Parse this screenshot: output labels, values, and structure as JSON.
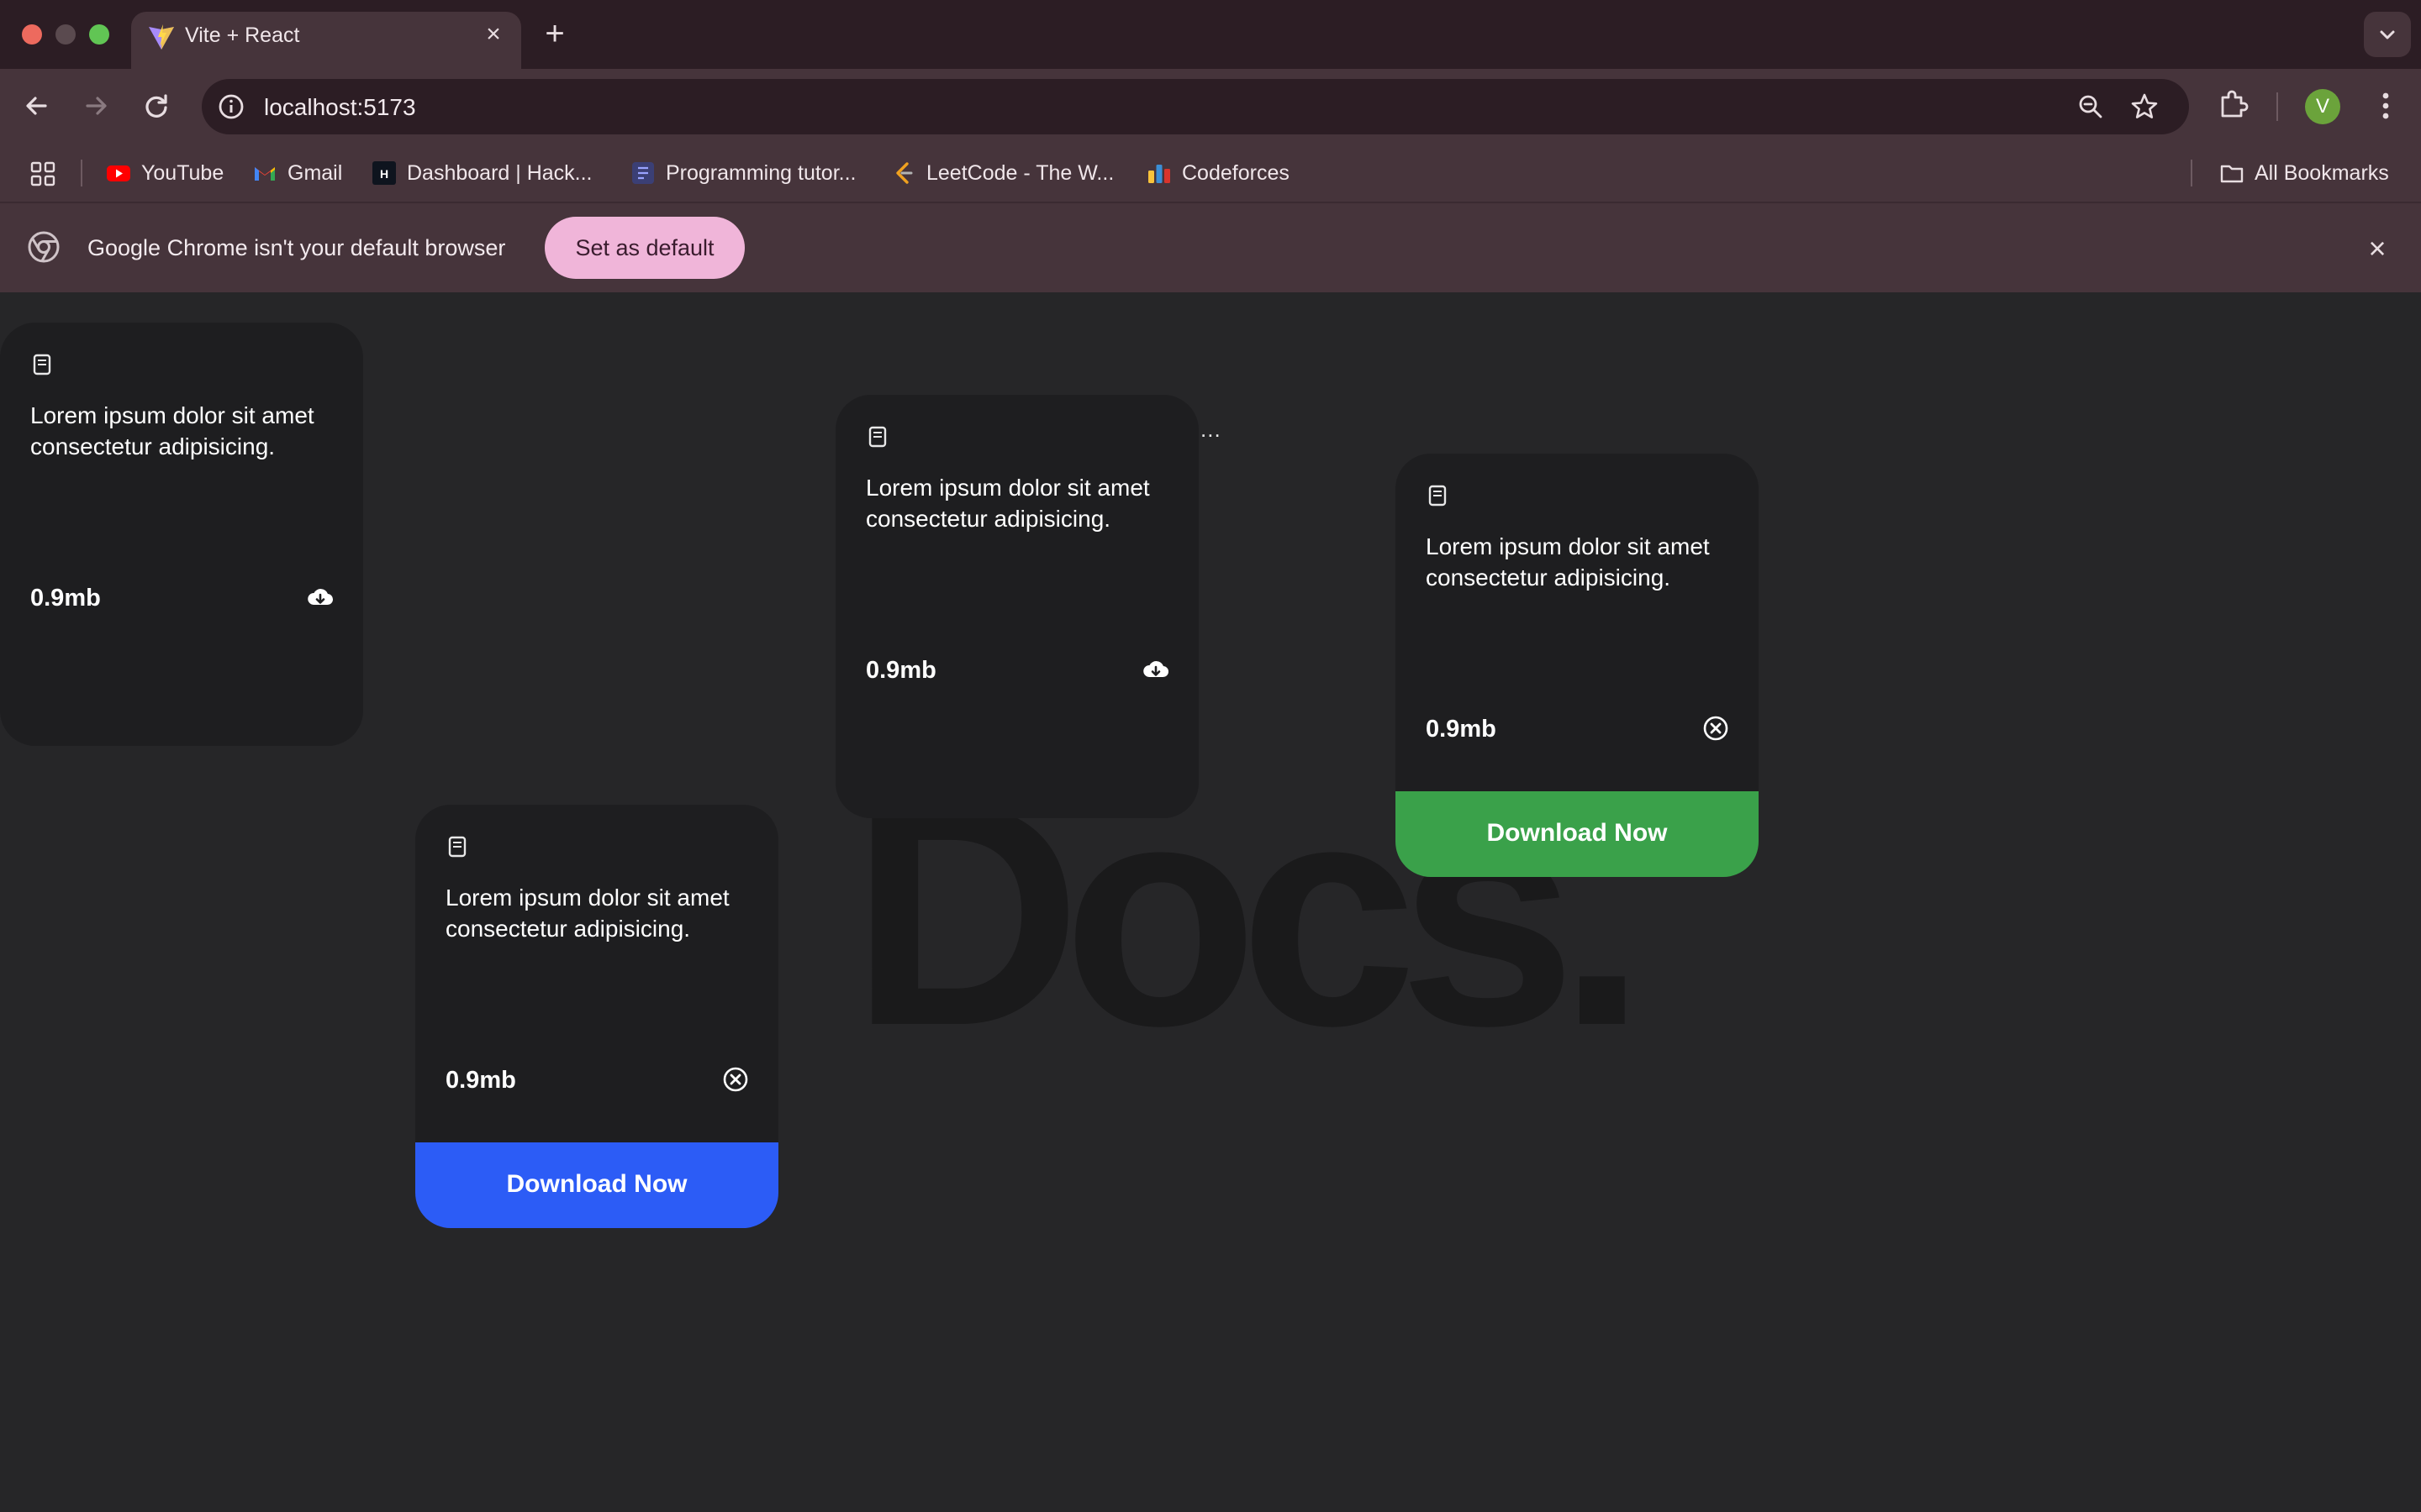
{
  "browser": {
    "tab_title": "Vite + React",
    "url": "localhost:5173",
    "profile_initial": "V",
    "bookmarks": [
      {
        "label": "YouTube",
        "icon": "youtube-icon"
      },
      {
        "label": "Gmail",
        "icon": "gmail-icon"
      },
      {
        "label": "Dashboard | Hack...",
        "icon": "hackerrank-icon"
      },
      {
        "label": "Programming tutor...",
        "icon": "tutorial-icon"
      },
      {
        "label": "LeetCode - The W...",
        "icon": "leetcode-icon"
      },
      {
        "label": "Codeforces",
        "icon": "codeforces-icon"
      }
    ],
    "all_bookmarks_label": "All Bookmarks",
    "infobar": {
      "message": "Google Chrome isn't your default browser",
      "button_label": "Set as default"
    }
  },
  "page": {
    "background_text": "Docs.",
    "more_label": "...",
    "cards": [
      {
        "description": "Lorem ipsum dolor sit amet consectetur adipisicing.",
        "size": "0.9mb",
        "action_icon": "cloud-download-icon",
        "button": null
      },
      {
        "description": "Lorem ipsum dolor sit amet consectetur adipisicing.",
        "size": "0.9mb",
        "action_icon": "cloud-download-icon",
        "button": null
      },
      {
        "description": "Lorem ipsum dolor sit amet consectetur adipisicing.",
        "size": "0.9mb",
        "action_icon": "close-circle-icon",
        "button": {
          "label": "Download Now",
          "color": "#3aa14a"
        }
      },
      {
        "description": "Lorem ipsum dolor sit amet consectetur adipisicing.",
        "size": "0.9mb",
        "action_icon": "close-circle-icon",
        "button": {
          "label": "Download Now",
          "color": "#2c5cf6"
        }
      }
    ]
  }
}
